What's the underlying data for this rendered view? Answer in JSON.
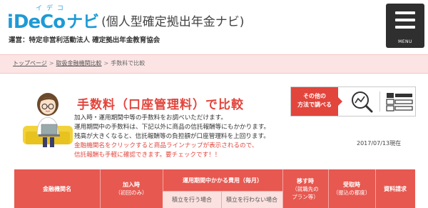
{
  "header": {
    "logo_ruby": "イデコ",
    "logo_i": "i",
    "logo_deco": "DeCo",
    "logo_navi": "ナビ",
    "logo_sub": "(個人型確定拠出年金ナビ)",
    "operator": "運営：特定非営利活動法人 確定拠出年金教育協会",
    "menu_label": "MENU"
  },
  "breadcrumb": {
    "items": [
      "トップページ",
      "取扱金融機関比較",
      "手数料で比較"
    ],
    "separator": ">"
  },
  "main": {
    "title": "手数料（口座管理料）で比較",
    "desc_lines": [
      "加入時・運用期間中等の手数料をお調べいただけます。",
      "運用期間中の手数料は、下記以外に商品の信託報酬等にもかかります。",
      "残高が大きくなると、信託報酬等の負担額が口座管理料を上回ります。"
    ],
    "note_lines": [
      "金融機関名をクリックすると商品ラインナップが表示されるので、",
      "信託報酬も手軽に確認できます。要チェックです！！"
    ],
    "compare_label_1": "その他の",
    "compare_label_2": "方法で調べる",
    "date": "2017/07/13現在"
  },
  "table": {
    "col_institution": "金融機関名",
    "col_join_1": "加入時",
    "col_join_2": "（初回のみ）",
    "col_running": "運用期間中かかる費用（毎月）",
    "col_sub_with": "積立を行う場合",
    "col_sub_without": "積立を行わない場合",
    "col_transfer_1": "移す時",
    "col_transfer_2": "（就職先の",
    "col_transfer_3": "プラン等）",
    "col_benefit_1": "受取時",
    "col_benefit_2": "（振込の都度）",
    "col_docs": "資料請求"
  },
  "colors": {
    "accent_red": "#e2453c",
    "table_header": "#e75850",
    "breadcrumb_bg": "#fce4e4",
    "brand_blue": "#1e9ad6"
  }
}
